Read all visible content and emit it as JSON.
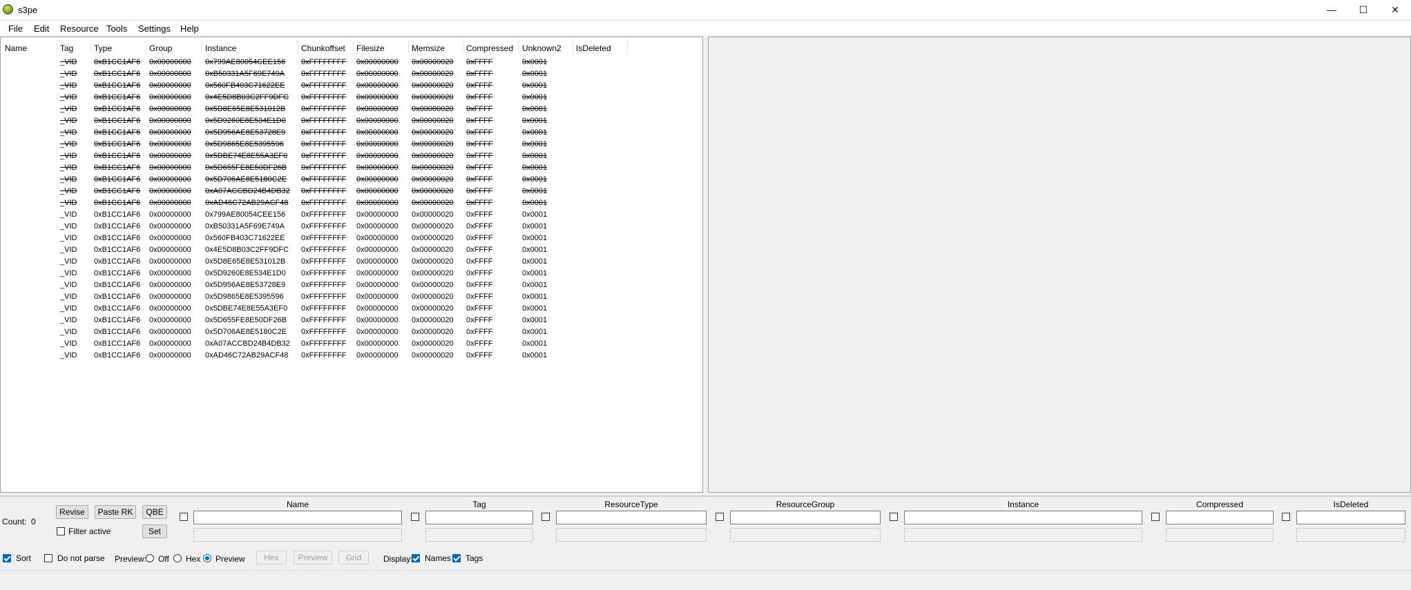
{
  "window": {
    "title": "s3pe",
    "min_glyph": "—",
    "max_glyph": "☐",
    "close_glyph": "✕"
  },
  "menu": [
    "File",
    "Edit",
    "Resource",
    "Tools",
    "Settings",
    "Help"
  ],
  "columns": [
    "Name",
    "Tag",
    "Type",
    "Group",
    "Instance",
    "Chunkoffset",
    "Filesize",
    "Memsize",
    "Compressed",
    "Unknown2",
    "IsDeleted"
  ],
  "rows": [
    {
      "name": "",
      "tag": "_VID",
      "type": "0xB1CC1AF6",
      "group": "0x00000000",
      "instance": "0x799AE80054CEE156",
      "chunkoffset": "0xFFFFFFFF",
      "filesize": "0x00000000",
      "memsize": "0x00000020",
      "compressed": "0xFFFF",
      "unknown2": "0x0001",
      "deleted": true
    },
    {
      "name": "",
      "tag": "_VID",
      "type": "0xB1CC1AF6",
      "group": "0x00000000",
      "instance": "0xB50331A5F69E749A",
      "chunkoffset": "0xFFFFFFFF",
      "filesize": "0x00000000",
      "memsize": "0x00000020",
      "compressed": "0xFFFF",
      "unknown2": "0x0001",
      "deleted": true
    },
    {
      "name": "",
      "tag": "_VID",
      "type": "0xB1CC1AF6",
      "group": "0x00000000",
      "instance": "0x560FB403C71622EE",
      "chunkoffset": "0xFFFFFFFF",
      "filesize": "0x00000000",
      "memsize": "0x00000020",
      "compressed": "0xFFFF",
      "unknown2": "0x0001",
      "deleted": true
    },
    {
      "name": "",
      "tag": "_VID",
      "type": "0xB1CC1AF6",
      "group": "0x00000000",
      "instance": "0x4E5D8B03C2FF9DFC",
      "chunkoffset": "0xFFFFFFFF",
      "filesize": "0x00000000",
      "memsize": "0x00000020",
      "compressed": "0xFFFF",
      "unknown2": "0x0001",
      "deleted": true
    },
    {
      "name": "",
      "tag": "_VID",
      "type": "0xB1CC1AF6",
      "group": "0x00000000",
      "instance": "0x5D8E65E8E531012B",
      "chunkoffset": "0xFFFFFFFF",
      "filesize": "0x00000000",
      "memsize": "0x00000020",
      "compressed": "0xFFFF",
      "unknown2": "0x0001",
      "deleted": true
    },
    {
      "name": "",
      "tag": "_VID",
      "type": "0xB1CC1AF6",
      "group": "0x00000000",
      "instance": "0x5D9260E8E534E1D0",
      "chunkoffset": "0xFFFFFFFF",
      "filesize": "0x00000000",
      "memsize": "0x00000020",
      "compressed": "0xFFFF",
      "unknown2": "0x0001",
      "deleted": true
    },
    {
      "name": "",
      "tag": "_VID",
      "type": "0xB1CC1AF6",
      "group": "0x00000000",
      "instance": "0x5D956AE8E53728E9",
      "chunkoffset": "0xFFFFFFFF",
      "filesize": "0x00000000",
      "memsize": "0x00000020",
      "compressed": "0xFFFF",
      "unknown2": "0x0001",
      "deleted": true
    },
    {
      "name": "",
      "tag": "_VID",
      "type": "0xB1CC1AF6",
      "group": "0x00000000",
      "instance": "0x5D9865E8E5395596",
      "chunkoffset": "0xFFFFFFFF",
      "filesize": "0x00000000",
      "memsize": "0x00000020",
      "compressed": "0xFFFF",
      "unknown2": "0x0001",
      "deleted": true
    },
    {
      "name": "",
      "tag": "_VID",
      "type": "0xB1CC1AF6",
      "group": "0x00000000",
      "instance": "0x5DBE74E8E55A3EF0",
      "chunkoffset": "0xFFFFFFFF",
      "filesize": "0x00000000",
      "memsize": "0x00000020",
      "compressed": "0xFFFF",
      "unknown2": "0x0001",
      "deleted": true
    },
    {
      "name": "",
      "tag": "_VID",
      "type": "0xB1CC1AF6",
      "group": "0x00000000",
      "instance": "0x5D655FE8E50DF26B",
      "chunkoffset": "0xFFFFFFFF",
      "filesize": "0x00000000",
      "memsize": "0x00000020",
      "compressed": "0xFFFF",
      "unknown2": "0x0001",
      "deleted": true
    },
    {
      "name": "",
      "tag": "_VID",
      "type": "0xB1CC1AF6",
      "group": "0x00000000",
      "instance": "0x5D706AE8E5180C2E",
      "chunkoffset": "0xFFFFFFFF",
      "filesize": "0x00000000",
      "memsize": "0x00000020",
      "compressed": "0xFFFF",
      "unknown2": "0x0001",
      "deleted": true
    },
    {
      "name": "",
      "tag": "_VID",
      "type": "0xB1CC1AF6",
      "group": "0x00000000",
      "instance": "0xA07ACCBD24B4DB32",
      "chunkoffset": "0xFFFFFFFF",
      "filesize": "0x00000000",
      "memsize": "0x00000020",
      "compressed": "0xFFFF",
      "unknown2": "0x0001",
      "deleted": true
    },
    {
      "name": "",
      "tag": "_VID",
      "type": "0xB1CC1AF6",
      "group": "0x00000000",
      "instance": "0xAD46C72AB29ACF48",
      "chunkoffset": "0xFFFFFFFF",
      "filesize": "0x00000000",
      "memsize": "0x00000020",
      "compressed": "0xFFFF",
      "unknown2": "0x0001",
      "deleted": true
    },
    {
      "name": "",
      "tag": "_VID",
      "type": "0xB1CC1AF6",
      "group": "0x00000000",
      "instance": "0x799AE80054CEE156",
      "chunkoffset": "0xFFFFFFFF",
      "filesize": "0x00000000",
      "memsize": "0x00000020",
      "compressed": "0xFFFF",
      "unknown2": "0x0001",
      "deleted": false
    },
    {
      "name": "",
      "tag": "_VID",
      "type": "0xB1CC1AF6",
      "group": "0x00000000",
      "instance": "0xB50331A5F69E749A",
      "chunkoffset": "0xFFFFFFFF",
      "filesize": "0x00000000",
      "memsize": "0x00000020",
      "compressed": "0xFFFF",
      "unknown2": "0x0001",
      "deleted": false
    },
    {
      "name": "",
      "tag": "_VID",
      "type": "0xB1CC1AF6",
      "group": "0x00000000",
      "instance": "0x560FB403C71622EE",
      "chunkoffset": "0xFFFFFFFF",
      "filesize": "0x00000000",
      "memsize": "0x00000020",
      "compressed": "0xFFFF",
      "unknown2": "0x0001",
      "deleted": false
    },
    {
      "name": "",
      "tag": "_VID",
      "type": "0xB1CC1AF6",
      "group": "0x00000000",
      "instance": "0x4E5D8B03C2FF9DFC",
      "chunkoffset": "0xFFFFFFFF",
      "filesize": "0x00000000",
      "memsize": "0x00000020",
      "compressed": "0xFFFF",
      "unknown2": "0x0001",
      "deleted": false
    },
    {
      "name": "",
      "tag": "_VID",
      "type": "0xB1CC1AF6",
      "group": "0x00000000",
      "instance": "0x5D8E65E8E531012B",
      "chunkoffset": "0xFFFFFFFF",
      "filesize": "0x00000000",
      "memsize": "0x00000020",
      "compressed": "0xFFFF",
      "unknown2": "0x0001",
      "deleted": false
    },
    {
      "name": "",
      "tag": "_VID",
      "type": "0xB1CC1AF6",
      "group": "0x00000000",
      "instance": "0x5D9260E8E534E1D0",
      "chunkoffset": "0xFFFFFFFF",
      "filesize": "0x00000000",
      "memsize": "0x00000020",
      "compressed": "0xFFFF",
      "unknown2": "0x0001",
      "deleted": false
    },
    {
      "name": "",
      "tag": "_VID",
      "type": "0xB1CC1AF6",
      "group": "0x00000000",
      "instance": "0x5D956AE8E53728E9",
      "chunkoffset": "0xFFFFFFFF",
      "filesize": "0x00000000",
      "memsize": "0x00000020",
      "compressed": "0xFFFF",
      "unknown2": "0x0001",
      "deleted": false
    },
    {
      "name": "",
      "tag": "_VID",
      "type": "0xB1CC1AF6",
      "group": "0x00000000",
      "instance": "0x5D9865E8E5395596",
      "chunkoffset": "0xFFFFFFFF",
      "filesize": "0x00000000",
      "memsize": "0x00000020",
      "compressed": "0xFFFF",
      "unknown2": "0x0001",
      "deleted": false
    },
    {
      "name": "",
      "tag": "_VID",
      "type": "0xB1CC1AF6",
      "group": "0x00000000",
      "instance": "0x5DBE74E8E55A3EF0",
      "chunkoffset": "0xFFFFFFFF",
      "filesize": "0x00000000",
      "memsize": "0x00000020",
      "compressed": "0xFFFF",
      "unknown2": "0x0001",
      "deleted": false
    },
    {
      "name": "",
      "tag": "_VID",
      "type": "0xB1CC1AF6",
      "group": "0x00000000",
      "instance": "0x5D655FE8E50DF26B",
      "chunkoffset": "0xFFFFFFFF",
      "filesize": "0x00000000",
      "memsize": "0x00000020",
      "compressed": "0xFFFF",
      "unknown2": "0x0001",
      "deleted": false
    },
    {
      "name": "",
      "tag": "_VID",
      "type": "0xB1CC1AF6",
      "group": "0x00000000",
      "instance": "0x5D706AE8E5180C2E",
      "chunkoffset": "0xFFFFFFFF",
      "filesize": "0x00000000",
      "memsize": "0x00000020",
      "compressed": "0xFFFF",
      "unknown2": "0x0001",
      "deleted": false
    },
    {
      "name": "",
      "tag": "_VID",
      "type": "0xB1CC1AF6",
      "group": "0x00000000",
      "instance": "0xA07ACCBD24B4DB32",
      "chunkoffset": "0xFFFFFFFF",
      "filesize": "0x00000000",
      "memsize": "0x00000020",
      "compressed": "0xFFFF",
      "unknown2": "0x0001",
      "deleted": false
    },
    {
      "name": "",
      "tag": "_VID",
      "type": "0xB1CC1AF6",
      "group": "0x00000000",
      "instance": "0xAD46C72AB29ACF48",
      "chunkoffset": "0xFFFFFFFF",
      "filesize": "0x00000000",
      "memsize": "0x00000020",
      "compressed": "0xFFFF",
      "unknown2": "0x0001",
      "deleted": false
    }
  ],
  "bottom": {
    "count_label": "Count:",
    "count_value": "0",
    "revise": "Revise",
    "paste_rk": "Paste RK",
    "qbe": "QBE",
    "filter_active": "Filter active",
    "filter_active_checked": false,
    "set": "Set",
    "filters": [
      {
        "label": "Name",
        "checked": false
      },
      {
        "label": "Tag",
        "checked": false
      },
      {
        "label": "ResourceType",
        "checked": false
      },
      {
        "label": "ResourceGroup",
        "checked": false
      },
      {
        "label": "Instance",
        "checked": false
      },
      {
        "label": "Compressed",
        "checked": false
      },
      {
        "label": "IsDeleted",
        "checked": false
      }
    ],
    "sort": "Sort",
    "sort_checked": true,
    "do_not_parse": "Do not parse",
    "do_not_parse_checked": false,
    "preview_label": "Preview:",
    "preview_off": "Off",
    "preview_hex": "Hex",
    "preview_preview": "Preview",
    "preview_selected": "Preview",
    "hex_btn": "Hex",
    "preview_btn": "Preview",
    "grid_btn": "Grid",
    "display_label": "Display:",
    "names": "Names",
    "names_checked": true,
    "tags": "Tags",
    "tags_checked": true
  },
  "colors": {
    "accent": "#0067c0",
    "panel_bg": "#f0f0f0",
    "list_bg": "#ffffff"
  }
}
